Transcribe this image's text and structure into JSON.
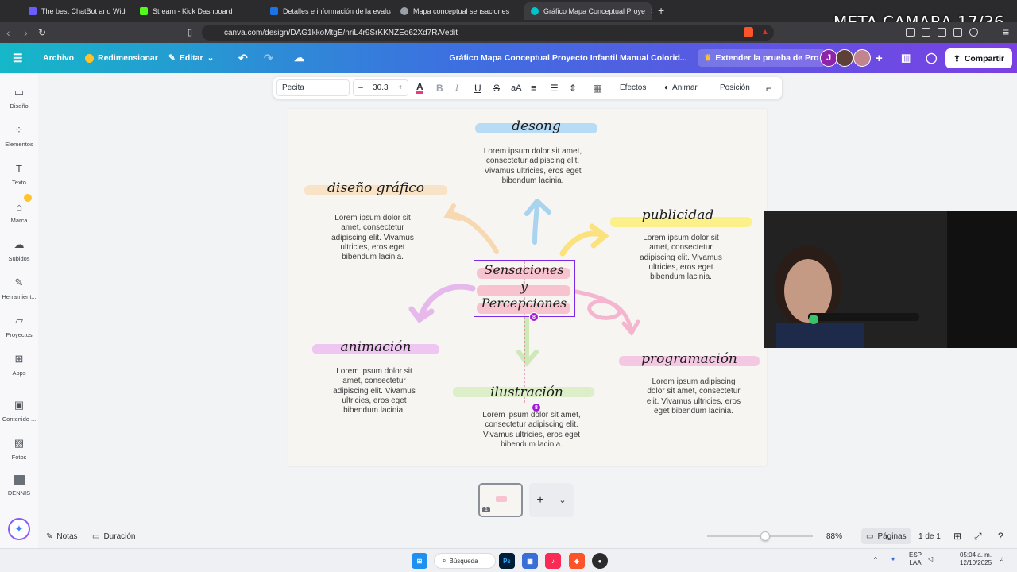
{
  "browser": {
    "tabs": [
      {
        "title": "The best ChatBot and Widgets fo",
        "color": "#6b5cff",
        "active": false
      },
      {
        "title": "Stream - Kick Dashboard",
        "color": "#53fc18",
        "active": false
      },
      {
        "title": "Detalles e información de la evaluaci",
        "color": "#1a73e8",
        "active": false
      },
      {
        "title": "Mapa conceptual sensaciones",
        "color": "#9aa0a6",
        "active": false
      },
      {
        "title": "Gráfico Mapa Conceptual Proye",
        "color": "#00c4cc",
        "active": true
      }
    ],
    "new_tab": "+",
    "url": "canva.com/design/DAG1kkoMtgE/nriL4r9SrKKNZEo62Xd7RA/edit"
  },
  "overlay": {
    "title": "META CAMARA 17/36"
  },
  "topbar": {
    "archivo": "Archivo",
    "redimensionar": "Redimensionar",
    "editar": "Editar",
    "doc_title": "Gráfico Mapa Conceptual Proyecto Infantil Manual Colorid...",
    "pro": "Extender la prueba de Pro",
    "avatar_initial": "J",
    "share": "Compartir"
  },
  "sidebar": {
    "items": [
      {
        "label": "Diseño",
        "icon": "layout-icon"
      },
      {
        "label": "Elementos",
        "icon": "shapes-icon"
      },
      {
        "label": "Texto",
        "icon": "text-icon"
      },
      {
        "label": "Marca",
        "icon": "brand-icon"
      },
      {
        "label": "Subidos",
        "icon": "upload-icon"
      },
      {
        "label": "Herramient...",
        "icon": "pen-icon"
      },
      {
        "label": "Proyectos",
        "icon": "folder-icon"
      },
      {
        "label": "Apps",
        "icon": "apps-icon"
      },
      {
        "label": "Contenido ...",
        "icon": "content-icon"
      },
      {
        "label": "Fotos",
        "icon": "photo-icon"
      },
      {
        "label": "DENNIS",
        "icon": "dennis-icon"
      }
    ]
  },
  "text_toolbar": {
    "font": "Pecita",
    "minus": "–",
    "size": "30.3",
    "plus": "+",
    "effects": "Efectos",
    "animate": "Animar",
    "position": "Posición"
  },
  "canvas": {
    "center": {
      "line1": "Sensaciones",
      "line2": "y",
      "line3": "Percepciones",
      "badge": "8"
    },
    "nodes": {
      "top": {
        "title": "desong",
        "text": "Lorem ipsum dolor sit amet, consectetur adipiscing elit. Vivamus ultricies, eros eget bibendum lacinia."
      },
      "diseno": {
        "title": "diseño gráfico",
        "text": "Lorem ipsum dolor sit amet, consectetur adipiscing elit. Vivamus ultricies, eros eget bibendum lacinia."
      },
      "publicidad": {
        "title": "publicidad",
        "text": "Lorem ipsum dolor sit amet, consectetur adipiscing elit. Vivamus ultricies, eros eget bibendum lacinia."
      },
      "animacion": {
        "title": "animación",
        "text": "Lorem ipsum dolor sit amet, consectetur adipiscing elit. Vivamus ultricies, eros eget bibendum lacinia."
      },
      "ilustracion": {
        "title": "ilustración",
        "text": "Lorem ipsum dolor sit amet, consectetur adipiscing elit. Vivamus ultricies, eros eget bibendum lacinia.",
        "badge": "8"
      },
      "programacion": {
        "title": "programación",
        "text": "Lorem ipsum adipiscing dolor sit amet, consectetur elit. Vivamus ultricies, eros eget bibendum lacinia."
      }
    }
  },
  "thumbnail": {
    "page_number": "1"
  },
  "bottom": {
    "notas": "Notas",
    "duracion": "Duración",
    "zoom": "88%",
    "zoom_fraction": 0.55,
    "pages": "Páginas",
    "page_count": "1 de 1"
  },
  "taskbar": {
    "search": "Búsqueda",
    "lang1": "ESP",
    "lang2": "LAA",
    "time": "05:04 a. m.",
    "date": "12/10/2025"
  }
}
